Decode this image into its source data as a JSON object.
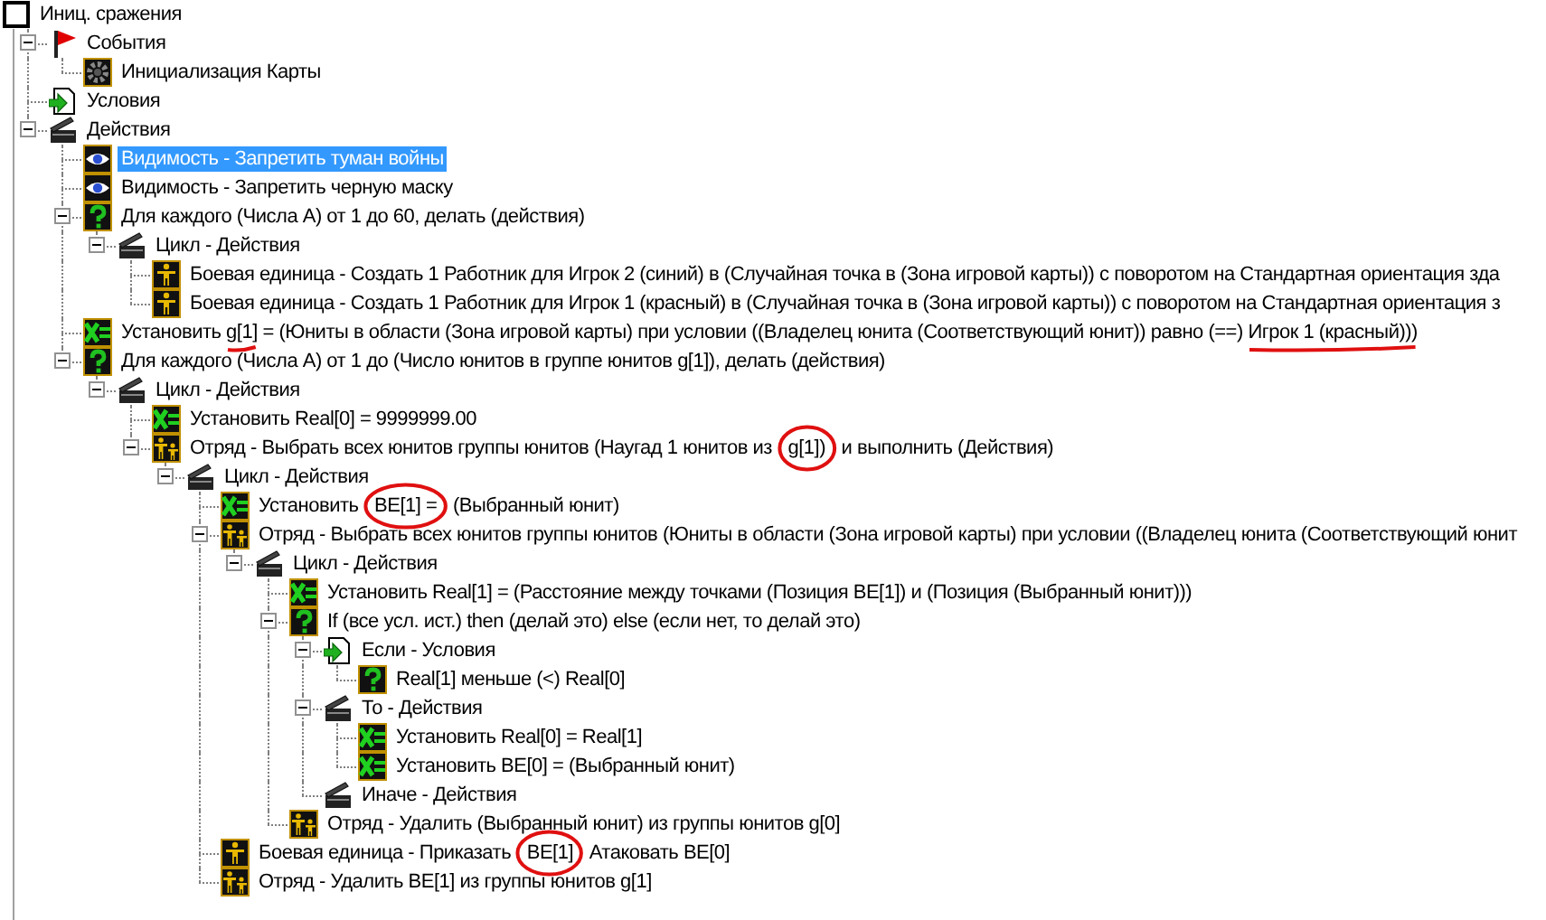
{
  "tree": {
    "text": "Иниц. сражения",
    "kind": "trigger",
    "selected": false,
    "children": [
      {
        "text": "События",
        "kind": "event",
        "selected": false,
        "expanded": true,
        "children": [
          {
            "text": "Инициализация Карты",
            "kind": "map-init",
            "selected": false
          }
        ]
      },
      {
        "text": "Условия",
        "kind": "conditions",
        "selected": false
      },
      {
        "text": "Действия",
        "kind": "actions",
        "selected": false,
        "expanded": true,
        "children": [
          {
            "text": "Видимость - Запретить туман войны",
            "kind": "visibility",
            "selected": true
          },
          {
            "text": "Видимость - Запретить черную маску",
            "kind": "visibility",
            "selected": false
          },
          {
            "text": "Для каждого (Числа А) от 1 до 60, делать (действия)",
            "kind": "question",
            "selected": false,
            "expanded": true,
            "children": [
              {
                "text": "Цикл - Действия",
                "kind": "actions",
                "selected": false,
                "expanded": true,
                "children": [
                  {
                    "text": "Боевая единица - Создать 1 Работник для Игрок 2 (синий) в (Случайная точка в (Зона игровой карты)) с поворотом на Стандартная ориентация зда",
                    "kind": "unit",
                    "selected": false
                  },
                  {
                    "text": "Боевая единица - Создать 1 Работник для Игрок 1 (красный) в (Случайная точка в (Зона игровой карты)) с поворотом на Стандартная ориентация з",
                    "kind": "unit",
                    "selected": false
                  }
                ]
              }
            ]
          },
          {
            "parts": [
              {
                "text": "Установить "
              },
              {
                "text": "g[1]",
                "kind": "underline"
              },
              {
                "text": " = (Юниты в области (Зона игровой карты) при условии ((Владелец юнита (Соответствующий юнит)) равно (==) "
              },
              {
                "text": "Игрок 1 (красный)))",
                "kind": "underline"
              }
            ],
            "kind": "set-variable",
            "selected": false
          },
          {
            "text": "Для каждого (Числа А) от 1 до (Число юнитов в группе юнитов g[1]), делать (действия)",
            "kind": "question",
            "selected": false,
            "expanded": true,
            "children": [
              {
                "text": "Цикл - Действия",
                "kind": "actions",
                "selected": false,
                "expanded": true,
                "children": [
                  {
                    "text": "Установить Real[0] = 9999999.00",
                    "kind": "set-variable",
                    "selected": false
                  },
                  {
                    "parts": [
                      {
                        "text": "Отряд - Выбрать всех юнитов группы юнитов (Наугад 1 юнитов из "
                      },
                      {
                        "text": "g[1])",
                        "kind": "circle"
                      },
                      {
                        "text": " и выполнить (Действия)"
                      }
                    ],
                    "kind": "unit-group",
                    "selected": false,
                    "expanded": true,
                    "children": [
                      {
                        "text": "Цикл - Действия",
                        "kind": "actions",
                        "selected": false,
                        "expanded": true,
                        "children": [
                          {
                            "parts": [
                              {
                                "text": "Установить "
                              },
                              {
                                "text": "BE[1] =",
                                "kind": "circle"
                              },
                              {
                                "text": " (Выбранный юнит)"
                              }
                            ],
                            "kind": "set-variable",
                            "selected": false
                          },
                          {
                            "text": "Отряд - Выбрать всех юнитов группы юнитов (Юниты в области (Зона игровой карты) при условии ((Владелец юнита (Соответствующий юнит",
                            "kind": "unit-group",
                            "selected": false,
                            "expanded": true,
                            "children": [
                              {
                                "text": "Цикл - Действия",
                                "kind": "actions",
                                "selected": false,
                                "expanded": true,
                                "children": [
                                  {
                                    "text": "Установить Real[1] = (Расстояние между точками (Позиция BE[1]) и (Позиция (Выбранный юнит)))",
                                    "kind": "set-variable",
                                    "selected": false
                                  },
                                  {
                                    "text": "If (все усл. ист.) then (делай это) else (если нет, то делай это)",
                                    "kind": "question",
                                    "selected": false,
                                    "expanded": true,
                                    "children": [
                                      {
                                        "text": "Если - Условия",
                                        "kind": "conditions",
                                        "selected": false,
                                        "expanded": true,
                                        "children": [
                                          {
                                            "text": "Real[1] меньше (<) Real[0]",
                                            "kind": "question",
                                            "selected": false
                                          }
                                        ]
                                      },
                                      {
                                        "text": "То - Действия",
                                        "kind": "actions",
                                        "selected": false,
                                        "expanded": true,
                                        "children": [
                                          {
                                            "text": "Установить Real[0] = Real[1]",
                                            "kind": "set-variable",
                                            "selected": false
                                          },
                                          {
                                            "text": "Установить BE[0] = (Выбранный юнит)",
                                            "kind": "set-variable",
                                            "selected": false
                                          }
                                        ]
                                      },
                                      {
                                        "text": "Иначе - Действия",
                                        "kind": "actions",
                                        "selected": false
                                      }
                                    ]
                                  },
                                  {
                                    "text": "Отряд - Удалить (Выбранный юнит) из группы юнитов g[0]",
                                    "kind": "unit-group",
                                    "selected": false
                                  }
                                ]
                              }
                            ]
                          },
                          {
                            "parts": [
                              {
                                "text": "Боевая единица - Приказать "
                              },
                              {
                                "text": "BE[1]",
                                "kind": "circle"
                              },
                              {
                                "text": " Атаковать BE[0]"
                              }
                            ],
                            "kind": "unit",
                            "selected": false
                          },
                          {
                            "text": "Отряд - Удалить BE[1] из группы юнитов g[1]",
                            "kind": "unit-group",
                            "selected": false
                          }
                        ]
                      }
                    ]
                  }
                ]
              }
            ]
          }
        ]
      }
    ]
  }
}
